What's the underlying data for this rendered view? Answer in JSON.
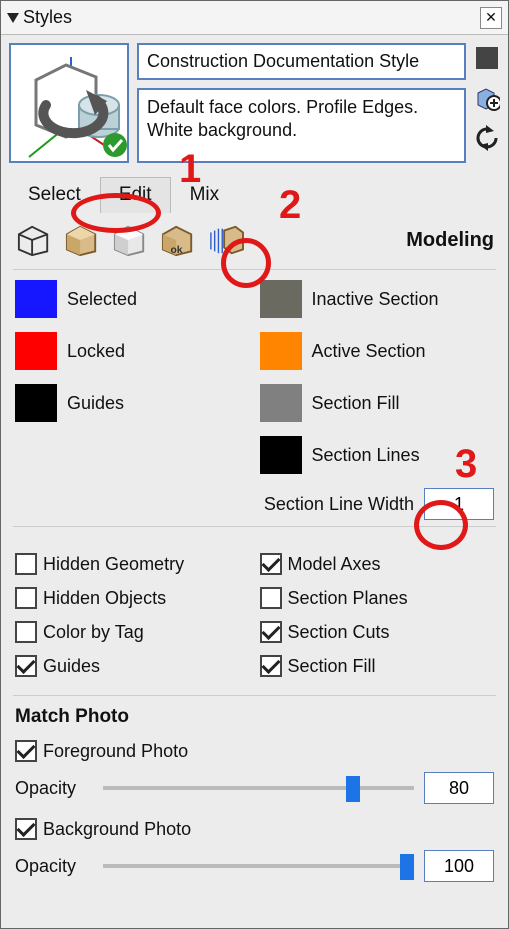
{
  "titlebar": {
    "title": "Styles"
  },
  "style": {
    "name": "Construction Documentation Style",
    "description": "Default face colors. Profile Edges. White background."
  },
  "tabs": {
    "select": "Select",
    "edit": "Edit",
    "mix": "Mix",
    "active": "edit"
  },
  "mode": {
    "section_title": "Modeling"
  },
  "colors": {
    "selected": {
      "label": "Selected",
      "hex": "#1717ff"
    },
    "locked": {
      "label": "Locked",
      "hex": "#ff0000"
    },
    "guides": {
      "label": "Guides",
      "hex": "#000000"
    },
    "inactive_section": {
      "label": "Inactive Section",
      "hex": "#6a6a60"
    },
    "active_section": {
      "label": "Active Section",
      "hex": "#ff8400"
    },
    "section_fill": {
      "label": "Section Fill",
      "hex": "#808080"
    },
    "section_lines": {
      "label": "Section Lines",
      "hex": "#000000"
    }
  },
  "section_line_width": {
    "label": "Section Line Width",
    "value": "1"
  },
  "checks": {
    "hidden_geometry": {
      "label": "Hidden Geometry",
      "checked": false
    },
    "hidden_objects": {
      "label": "Hidden Objects",
      "checked": false
    },
    "color_by_tag": {
      "label": "Color by Tag",
      "checked": false
    },
    "guides": {
      "label": "Guides",
      "checked": true
    },
    "model_axes": {
      "label": "Model Axes",
      "checked": true
    },
    "section_planes": {
      "label": "Section Planes",
      "checked": false
    },
    "section_cuts": {
      "label": "Section Cuts",
      "checked": true
    },
    "section_fill": {
      "label": "Section Fill",
      "checked": true
    }
  },
  "match_photo": {
    "heading": "Match Photo",
    "foreground": {
      "label": "Foreground Photo",
      "checked": true,
      "opacity_label": "Opacity",
      "opacity": "80"
    },
    "background": {
      "label": "Background Photo",
      "checked": true,
      "opacity_label": "Opacity",
      "opacity": "100"
    }
  },
  "annotations": {
    "one": "1",
    "two": "2",
    "three": "3"
  },
  "chart_data": null
}
